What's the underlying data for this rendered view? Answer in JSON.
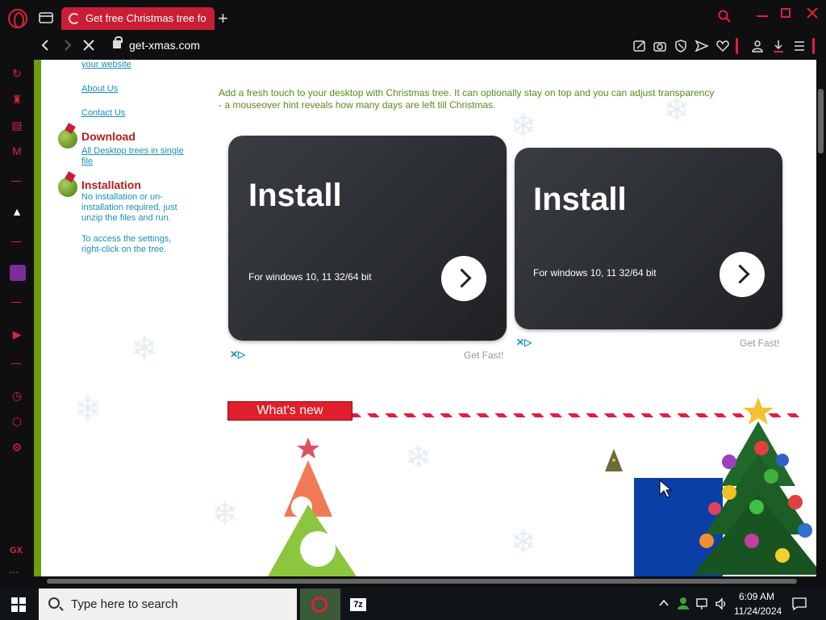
{
  "browser": {
    "tab_title": "Get free Christmas tree fo",
    "url": "get-xmas.com"
  },
  "left_nav": {
    "link_your_website": "your website",
    "link_about": "About Us",
    "link_contact": "Contact Us",
    "download_heading": "Download",
    "download_link_line1": "All Desktop trees in single",
    "download_link_line2": "file",
    "install_heading": "Installation",
    "install_text_1": "No installation or un-",
    "install_text_2": "installation required, just",
    "install_text_3": "unzip the files and run.",
    "settings_text_1": "To access the settings,",
    "settings_text_2": "right-click on the tree."
  },
  "main": {
    "intro_line1": "Add a fresh touch to your desktop with Christmas tree. It can optionally stay on top and you can adjust transparency",
    "intro_line2": "- a mouseover hint reveals how many days are left till Christmas.",
    "ads": [
      {
        "title": "Install",
        "subtitle": "For windows 10, 11 32/64 bit",
        "ad_label": "Get Fast!"
      },
      {
        "title": "Install",
        "subtitle": "For windows 10, 11 32/64 bit",
        "ad_label": "Get Fast!"
      }
    ],
    "whats_new_label": "What's new"
  },
  "taskbar": {
    "search_placeholder": "Type here to search",
    "app_label_7z": "7z",
    "clock_time": "6:09 AM",
    "clock_date": "11/24/2024"
  },
  "colors": {
    "accent": "#e0203a",
    "link": "#1a8fb8",
    "intro_text": "#5a8a1a",
    "heading_red": "#b81b1b"
  }
}
